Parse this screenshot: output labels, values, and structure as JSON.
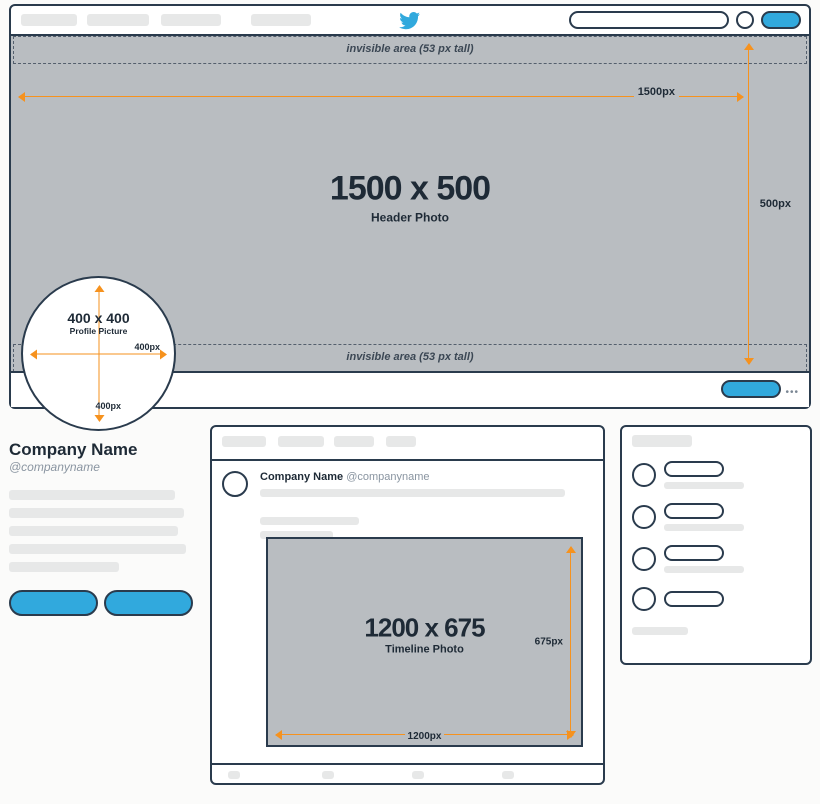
{
  "nav": {
    "search_placeholder": ""
  },
  "header": {
    "dimensions": "1500 x 500",
    "label": "Header Photo",
    "width_label": "1500px",
    "height_label": "500px",
    "invisible_label": "invisible area (53 px tall)"
  },
  "profile_picture": {
    "dimensions": "400 x 400",
    "label": "Profile Picture",
    "width_label": "400px",
    "height_label": "400px"
  },
  "company": {
    "name": "Company Name",
    "handle": "@companyname"
  },
  "timeline_post": {
    "name": "Company Name",
    "handle": "@companyname"
  },
  "timeline_photo": {
    "dimensions": "1200 x 675",
    "label": "Timeline Photo",
    "width_label": "1200px",
    "height_label": "675px"
  },
  "more_glyph": "•••"
}
